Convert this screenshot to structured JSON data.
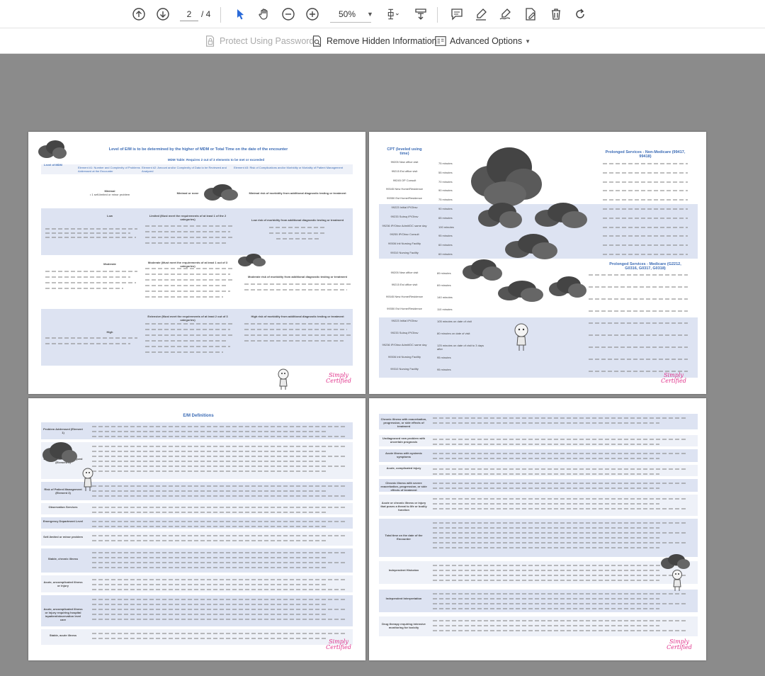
{
  "toolbar": {
    "prev_page_icon": "arrow-up-circle-icon",
    "next_page_icon": "arrow-down-circle-icon",
    "page_current": "2",
    "page_total": "/ 4",
    "zoom": "50%",
    "icons": [
      "pointer-icon",
      "hand-icon",
      "zoom-out-icon",
      "zoom-in-icon",
      "fit-page-icon",
      "page-view-icon",
      "comment-icon",
      "highlight-icon",
      "signature-icon",
      "edit-icon",
      "delete-icon",
      "rotate-icon"
    ]
  },
  "toolbar2": {
    "protect_label": "Protect Using Password",
    "remove_label": "Remove Hidden Information",
    "advanced_label": "Advanced Options"
  },
  "page1": {
    "title": "Level of E/M is to be determined by the higher of MDM or Total Time on the date of the encounter",
    "subtitle": "MDM Table: Requires 2 out of 3 elements to be met or exceeded",
    "col_level": "Level of MDM",
    "col1": "Element #1: Number and Complexity of Problems Addressed at the Encounter",
    "col2": "Element #2: Amount and/or Complexity of Data to be Reviewed and Analyzed",
    "col3": "Element #3: Risk of Complications and/or Morbidity or Mortality of Patient Management",
    "minimal": "Minimal",
    "minimal_desc": "• 1 self-limited or minor problem",
    "minimal_none": "Minimal or none",
    "minimal_risk": "Minimal risk of morbidity from additional diagnostic testing or treatment",
    "low": "Low",
    "low_data": "Limited (Must meet the requirements of at least 1 of the 2 categories)",
    "low_risk": "Low risk of morbidity from additional diagnostic testing or treatment",
    "moderate": "Moderate",
    "moderate_data": "Moderate (Must meet the requirements of at least 1 out of 3 categories)",
    "moderate_risk": "Moderate risk of morbidity from additional diagnostic testing or treatment",
    "high": "High",
    "high_data": "Extensive (Must meet the requirements of at least 2 out of 3 categories)",
    "high_risk": "High risk of morbidity from additional diagnostic testing or treatment",
    "brand": "Simply Certified"
  },
  "page2": {
    "cpt_head": "CPT (leveled using time)",
    "prolonged_nonmedicare": "Prolonged Services - Non-Medicare (99417, 99418)",
    "prolonged_medicare": "Prolonged Services - Medicare (G2212, G0316, G0317, G0318)",
    "rows": [
      {
        "code": "99205 New office visit",
        "time": "75 minutes"
      },
      {
        "code": "99215 Est office visit",
        "time": "55 minutes"
      },
      {
        "code": "99245 OP Consult",
        "time": "70 minutes"
      },
      {
        "code": "99345 New Home/Residence",
        "time": "90 minutes"
      },
      {
        "code": "99350 Est Home/Residence",
        "time": "75 minutes"
      },
      {
        "code": "99223 Initial IP/Obsv",
        "time": "90 minutes"
      },
      {
        "code": "99233 Subsq IP/Obsv",
        "time": "65 minutes"
      },
      {
        "code": "99236 IP/Obsv Admit/DC same day",
        "time": "100 minutes"
      },
      {
        "code": "99255 IP/Obsv Consult",
        "time": "95 minutes"
      },
      {
        "code": "99306 Init Nursing Facility",
        "time": "60 minutes"
      },
      {
        "code": "99310 Nursing Facility",
        "time": "60 minutes"
      }
    ],
    "rows_medicare": [
      {
        "code": "99205 New office visit",
        "time": "89 minutes"
      },
      {
        "code": "99215 Est office visit",
        "time": "69 minutes"
      },
      {
        "code": "99345 New Home/Residence",
        "time": "140 minutes"
      },
      {
        "code": "99350 Est Home/Residence",
        "time": "110 minutes"
      },
      {
        "code": "99223 Initial IP/Obsv",
        "time": "105 minutes on date of visit"
      },
      {
        "code": "99233 Subsq IP/Obsv",
        "time": "80 minutes on date of visit"
      },
      {
        "code": "99236 IP/Obsv Admit/DC same day",
        "time": "125 minutes on date of visit to 3 days after"
      },
      {
        "code": "99306 Init Nursing Facility",
        "time": "95 minutes"
      },
      {
        "code": "99310 Nursing Facility",
        "time": "95 minutes"
      }
    ],
    "brand": "Simply Certified"
  },
  "page3": {
    "title": "E/M Definitions",
    "terms": [
      "Problem Addressed (Element 1)",
      "Data Reviewed and Analyzed (Element 2)",
      "Risk of Patient Management (Element 3)",
      "Observation Services",
      "Emergency Department Level",
      "Self-limited or minor problem",
      "Stable, chronic illness",
      "Acute, uncomplicated illness or injury",
      "Acute, uncomplicated illness or injury requiring hospital inpatient/observation level care",
      "Stable, acute illness"
    ],
    "brand": "Simply Certified"
  },
  "page4": {
    "terms": [
      "Chronic illness with exacerbation, progression, or side effects of treatment",
      "Undiagnosed new problem with uncertain prognosis",
      "Acute illness with systemic symptoms",
      "Acute, complicated injury",
      "Chronic illness with severe exacerbation, progression, or side effects of treatment",
      "Acute or chronic illness or injury that poses a threat to life or bodily function",
      "Total time on the date of the Encounter",
      "Independent Historian",
      "Independent Interpretation",
      "Drug therapy requiring intensive monitoring for toxicity"
    ],
    "brand": "Simply Certified"
  }
}
